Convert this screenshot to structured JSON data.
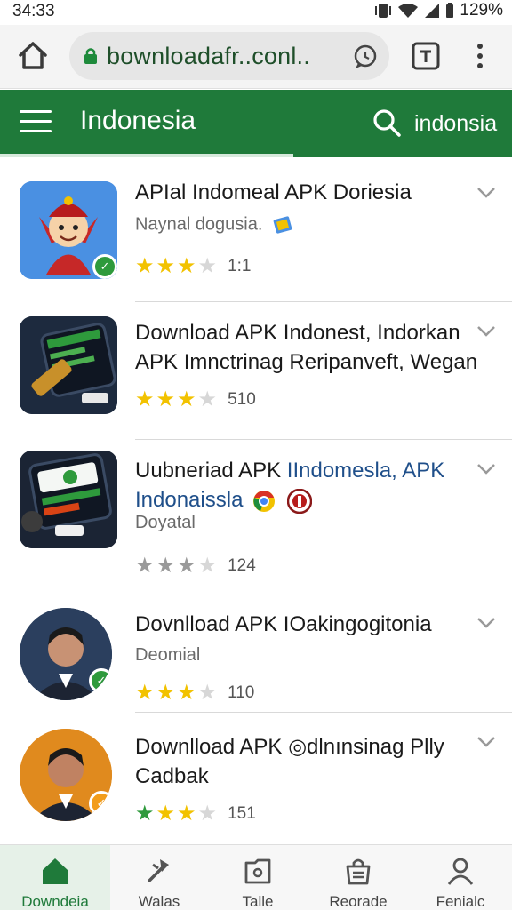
{
  "status_bar": {
    "time": "34:33",
    "battery": "129%"
  },
  "browser": {
    "url": "bownloadafr..conl..",
    "icons": [
      "home-icon",
      "lock-icon",
      "chat-icon",
      "tab-icon",
      "more-icon"
    ]
  },
  "header": {
    "title": "Indonesia",
    "search_text": "indonsia",
    "color": "#1f7a3a"
  },
  "items": [
    {
      "title": "APIal Indomeal APK Doriesia",
      "subtitle": "Naynal dogusia.",
      "rating": 3,
      "count": "1:1"
    },
    {
      "title": "Download APK Indonest, Indorkan APK Imnctrinag Reripanveft, Wegan",
      "subtitle": "",
      "rating": 3,
      "count": "510"
    },
    {
      "title_part1": "Uubneriad APK ",
      "title_part2": "IIndomesla, APK Indonaissla",
      "subtitle": "Doyatal",
      "rating": 3,
      "count": "124"
    },
    {
      "title": "Dovnlload APK IOakingogitonia",
      "subtitle": "Deomial",
      "rating": 3,
      "count": "110"
    },
    {
      "title": "Downlload APK ◎dlnınsinag Plly Cadbak",
      "subtitle": "",
      "rating": 3,
      "count": "151"
    }
  ],
  "bottom_nav": [
    {
      "label": "Downdeia",
      "icon": "home-icon",
      "active": true
    },
    {
      "label": "Walas",
      "icon": "wand-icon",
      "active": false
    },
    {
      "label": "Talle",
      "icon": "folder-icon",
      "active": false
    },
    {
      "label": "Reorade",
      "icon": "bag-icon",
      "active": false
    },
    {
      "label": "Fenialc",
      "icon": "person-icon",
      "active": false
    }
  ]
}
